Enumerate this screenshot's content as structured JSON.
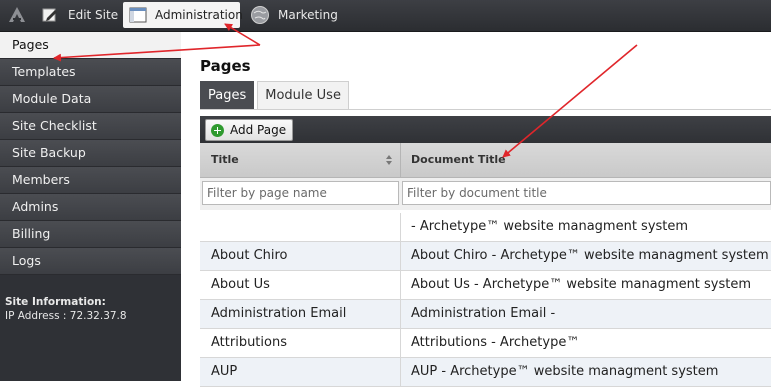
{
  "topbar": {
    "edit_site": "Edit Site",
    "administration": "Administration",
    "marketing": "Marketing"
  },
  "sidebar": {
    "items": [
      {
        "label": "Pages",
        "active": true
      },
      {
        "label": "Templates"
      },
      {
        "label": "Module Data"
      },
      {
        "label": "Site Checklist"
      },
      {
        "label": "Site Backup"
      },
      {
        "label": "Members"
      },
      {
        "label": "Admins"
      },
      {
        "label": "Billing"
      },
      {
        "label": "Logs"
      }
    ],
    "site_info_header": "Site Information:",
    "ip_address": "IP Address : 72.32.37.8"
  },
  "main": {
    "title": "Pages",
    "tabs": [
      "Pages",
      "Module Use"
    ],
    "add_button": "Add Page",
    "columns": {
      "title": "Title",
      "document_title": "Document Title"
    },
    "filters": {
      "title_placeholder": "Filter by page name",
      "doc_placeholder": "Filter by document title"
    },
    "rows": [
      {
        "title": "",
        "doc": "- Archetype™ website managment system"
      },
      {
        "title": "About Chiro",
        "doc": "About Chiro - Archetype™ website managment system"
      },
      {
        "title": "About Us",
        "doc": "About Us - Archetype™ website managment system"
      },
      {
        "title": "Administration Email",
        "doc": "Administration Email -"
      },
      {
        "title": "Attributions",
        "doc": "Attributions - Archetype™"
      },
      {
        "title": "AUP",
        "doc": "AUP - Archetype™ website managment system"
      }
    ]
  },
  "colors": {
    "annotation_arrow": "#e0262b",
    "add_icon_green": "#2f9a2f",
    "row_alt": "#eef2f7"
  }
}
